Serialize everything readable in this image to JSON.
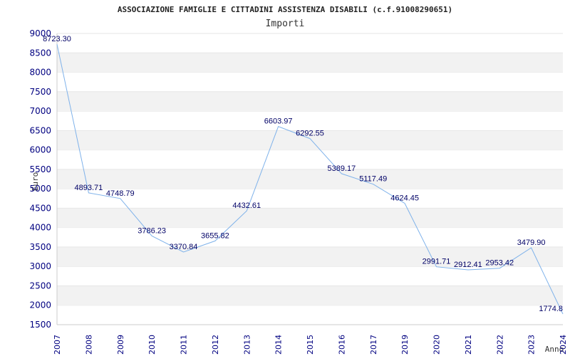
{
  "chart_data": {
    "type": "line",
    "title": "ASSOCIAZIONE FAMIGLIE E CITTADINI ASSISTENZA DISABILI (c.f.91008290651)",
    "subtitle": "Importi",
    "xlabel": "Anno",
    "ylabel": "Euro",
    "categories": [
      "2007",
      "2008",
      "2009",
      "2010",
      "2011",
      "2012",
      "2013",
      "2014",
      "2015",
      "2016",
      "2017",
      "2019",
      "2020",
      "2021",
      "2022",
      "2023",
      "2024"
    ],
    "series": [
      {
        "values": [
          8723.3,
          4893.71,
          4748.79,
          3786.23,
          3370.84,
          3655.82,
          4432.61,
          6603.97,
          6292.55,
          5389.17,
          5117.49,
          4624.45,
          2991.71,
          2912.41,
          2953.42,
          3479.9,
          1774.8
        ],
        "labels": [
          "8723.30",
          "4893.71",
          "4748.79",
          "3786.23",
          "3370.84",
          "3655.82",
          "4432.61",
          "6603.97",
          "6292.55",
          "5389.17",
          "5117.49",
          "4624.45",
          "2991.71",
          "2912.41",
          "2953.42",
          "3479.90",
          "1774.8"
        ]
      }
    ],
    "ylim": [
      1500,
      9000
    ],
    "yticks": [
      1500,
      2000,
      2500,
      3000,
      3500,
      4000,
      4500,
      5000,
      5500,
      6000,
      6500,
      7000,
      7500,
      8000,
      8500,
      9000
    ],
    "grid": true,
    "colors": {
      "line": "#7fb2ea",
      "band": "#f2f2f2",
      "gridline": "#e6e6e6",
      "axis_text": "#000080",
      "label_text": "#000066"
    }
  }
}
